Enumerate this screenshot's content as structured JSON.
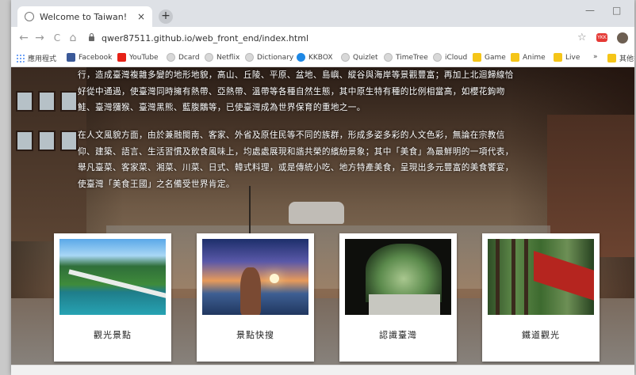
{
  "browser": {
    "tab_title": "Welcome to Taiwan!",
    "tab_close": "×",
    "new_tab": "+",
    "url": "qwer87511.github.io/web_front_end/index.html",
    "nav": {
      "back": "←",
      "forward": "→",
      "reload": "C",
      "home": "⌂"
    },
    "window": {
      "minimize": "—",
      "maximize": "□"
    },
    "star": "☆",
    "ext_badge": "YKK"
  },
  "bookmarks": [
    {
      "label": "應用程式",
      "icon": "apps-icon"
    },
    {
      "label": "Facebook",
      "icon": "facebook-icon"
    },
    {
      "label": "YouTube",
      "icon": "youtube-icon"
    },
    {
      "label": "Dcard",
      "icon": "globe-icon"
    },
    {
      "label": "Netflix",
      "icon": "globe-icon"
    },
    {
      "label": "Dictionary",
      "icon": "globe-icon"
    },
    {
      "label": "KKBOX",
      "icon": "kkbox-icon"
    },
    {
      "label": "Quizlet",
      "icon": "globe-icon"
    },
    {
      "label": "TimeTree",
      "icon": "globe-icon"
    },
    {
      "label": "iCloud",
      "icon": "globe-icon"
    },
    {
      "label": "Game",
      "icon": "folder-icon"
    },
    {
      "label": "Anime",
      "icon": "folder-icon"
    },
    {
      "label": "Live",
      "icon": "folder-icon"
    },
    {
      "label": "»",
      "icon": ""
    },
    {
      "label": "其他書籤",
      "icon": "folder-icon"
    }
  ],
  "page": {
    "paragraph1": [
      "行，造成臺灣複雜多變的地形地貌，高山、丘陵、平原、盆地、島嶼、縱谷與海岸等景觀豐富；再加上北迴歸線恰",
      "好從中通過，使臺灣同時擁有熱帶、亞熱帶、溫帶等各種自然生態，其中原生特有種的比例相當高，如櫻花鉤吻",
      "鮭、臺灣獼猴、臺灣黑熊、藍腹鷴等，已使臺灣成為世界保育的重地之一。"
    ],
    "paragraph2": [
      "在人文風貌方面，由於兼融閩南、客家、外省及原住民等不同的族群，形成多姿多彩的人文色彩，無論在宗教信",
      "仰、建築、語言、生活習慣及飲食風味上，均處處展現和諧共榮的繽紛景象；其中「美食」為最鮮明的一項代表，",
      "舉凡臺菜、客家菜、湘菜、川菜、日式、韓式料理，或是傳統小吃、地方特產美食，呈現出多元豐富的美食饗宴，",
      "使臺灣「美食王國」之名備受世界肯定。"
    ],
    "cards": [
      {
        "label": "觀光景點"
      },
      {
        "label": "景點快搜"
      },
      {
        "label": "認識臺灣"
      },
      {
        "label": "鐵道觀光"
      }
    ]
  }
}
